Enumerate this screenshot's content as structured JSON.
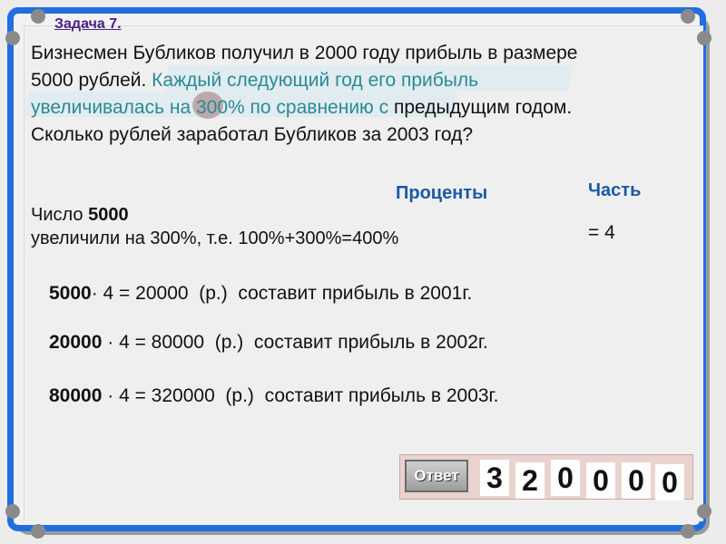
{
  "title": "Задача 7.",
  "problem": {
    "p1": "Бизнесмен Бубликов получил в 2000 году прибыль в размере",
    "p2a": "5000 рублей.",
    "p2b": "Каждый следующий год его прибыль",
    "p3a": "увеличивалась",
    "p3b": "на",
    "p3c": "300% по сравнению с",
    "p3d": "предыдущим годом.",
    "p4": "Сколько рублей заработал Бубликов за 2003 год?"
  },
  "headers": {
    "percent": "Проценты",
    "part": "Часть"
  },
  "number_line": {
    "label": "Число",
    "value": "5000"
  },
  "increase_line": "увеличили на 300%, т.е. 100%+300%=400%",
  "part_value": "= 4",
  "calculations": [
    {
      "base": "5000",
      "expr": "· 4 = 20000  (р.)  составит прибыль в 2001г."
    },
    {
      "base": "20000",
      "expr": " · 4 = 80000  (р.)  составит прибыль в 2002г."
    },
    {
      "base": "80000",
      "expr": " · 4 = 320000  (р.)  составит прибыль в 2003г."
    }
  ],
  "answer": {
    "button_label": "Ответ",
    "digits": [
      "3",
      "2",
      "0",
      "0",
      "0",
      "0"
    ]
  },
  "colors": {
    "frame": "#1f6fe0",
    "accent_text": "#2b8a96",
    "header": "#1a5aa6",
    "title": "#4a1f86"
  }
}
